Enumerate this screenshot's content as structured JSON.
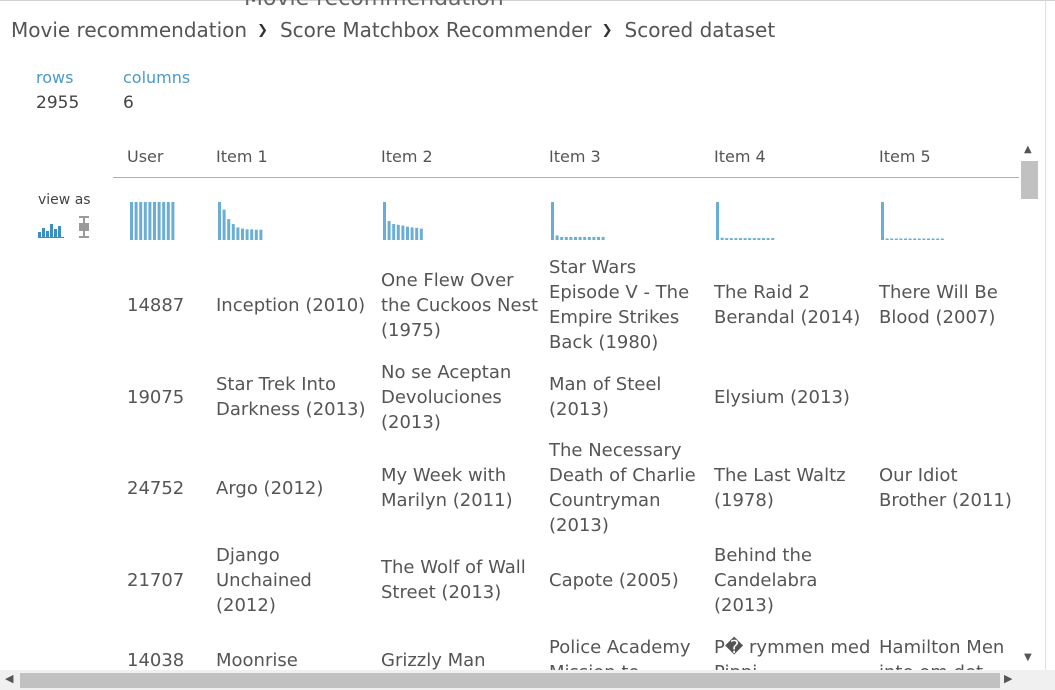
{
  "page": {
    "clipped_title": "Movie recommendation",
    "breadcrumb": [
      "Movie recommendation",
      "Score Matchbox Recommender",
      "Scored dataset"
    ]
  },
  "stats": {
    "rows_label": "rows",
    "rows_value": "2955",
    "columns_label": "columns",
    "columns_value": "6"
  },
  "view_as": {
    "label": "view as",
    "icons": [
      "histogram-icon",
      "boxplot-icon"
    ]
  },
  "columns": [
    "User",
    "Item 1",
    "Item 2",
    "Item 3",
    "Item 4",
    "Item 5"
  ],
  "column_histograms": [
    [
      1,
      1,
      1,
      1,
      1,
      1,
      1,
      1,
      1,
      1
    ],
    [
      1,
      0.8,
      0.55,
      0.42,
      0.33,
      0.3,
      0.28,
      0.28,
      0.27,
      0.27
    ],
    [
      1,
      0.5,
      0.42,
      0.4,
      0.38,
      0.35,
      0.33,
      0.32,
      0.3
    ],
    [
      1,
      0.12,
      0.08,
      0.08,
      0.08,
      0.08,
      0.08,
      0.08,
      0.08,
      0.08,
      0.08,
      0.08
    ],
    [
      1,
      0.06,
      0.05,
      0.05,
      0.05,
      0.05,
      0.05,
      0.05,
      0.05,
      0.05,
      0.05,
      0.05,
      0.05
    ],
    [
      1,
      0.04,
      0.04,
      0.04,
      0.04,
      0.04,
      0.04,
      0.04,
      0.04,
      0.04,
      0.04,
      0.04,
      0.04,
      0.04
    ]
  ],
  "rows": [
    [
      "14887",
      "Inception (2010)",
      "One Flew Over the Cuckoos Nest (1975)",
      "Star Wars Episode V - The Empire Strikes Back (1980)",
      "The Raid 2 Berandal (2014)",
      "There Will Be Blood (2007)"
    ],
    [
      "19075",
      "Star Trek Into Darkness (2013)",
      "No se Aceptan Devoluciones (2013)",
      "Man of Steel (2013)",
      "Elysium (2013)",
      ""
    ],
    [
      "24752",
      "Argo (2012)",
      "My Week with Marilyn (2011)",
      "The Necessary Death of Charlie Countryman (2013)",
      "The Last Waltz (1978)",
      "Our Idiot Brother (2011)"
    ],
    [
      "21707",
      "Django Unchained (2012)",
      "The Wolf of Wall Street (2013)",
      "Capote (2005)",
      "Behind the Candelabra (2013)",
      ""
    ],
    [
      "14038",
      "Moonrise",
      "Grizzly Man",
      "Police Academy Mission to",
      "P� rymmen med Pippi",
      "Hamilton Men inte om det"
    ]
  ]
}
